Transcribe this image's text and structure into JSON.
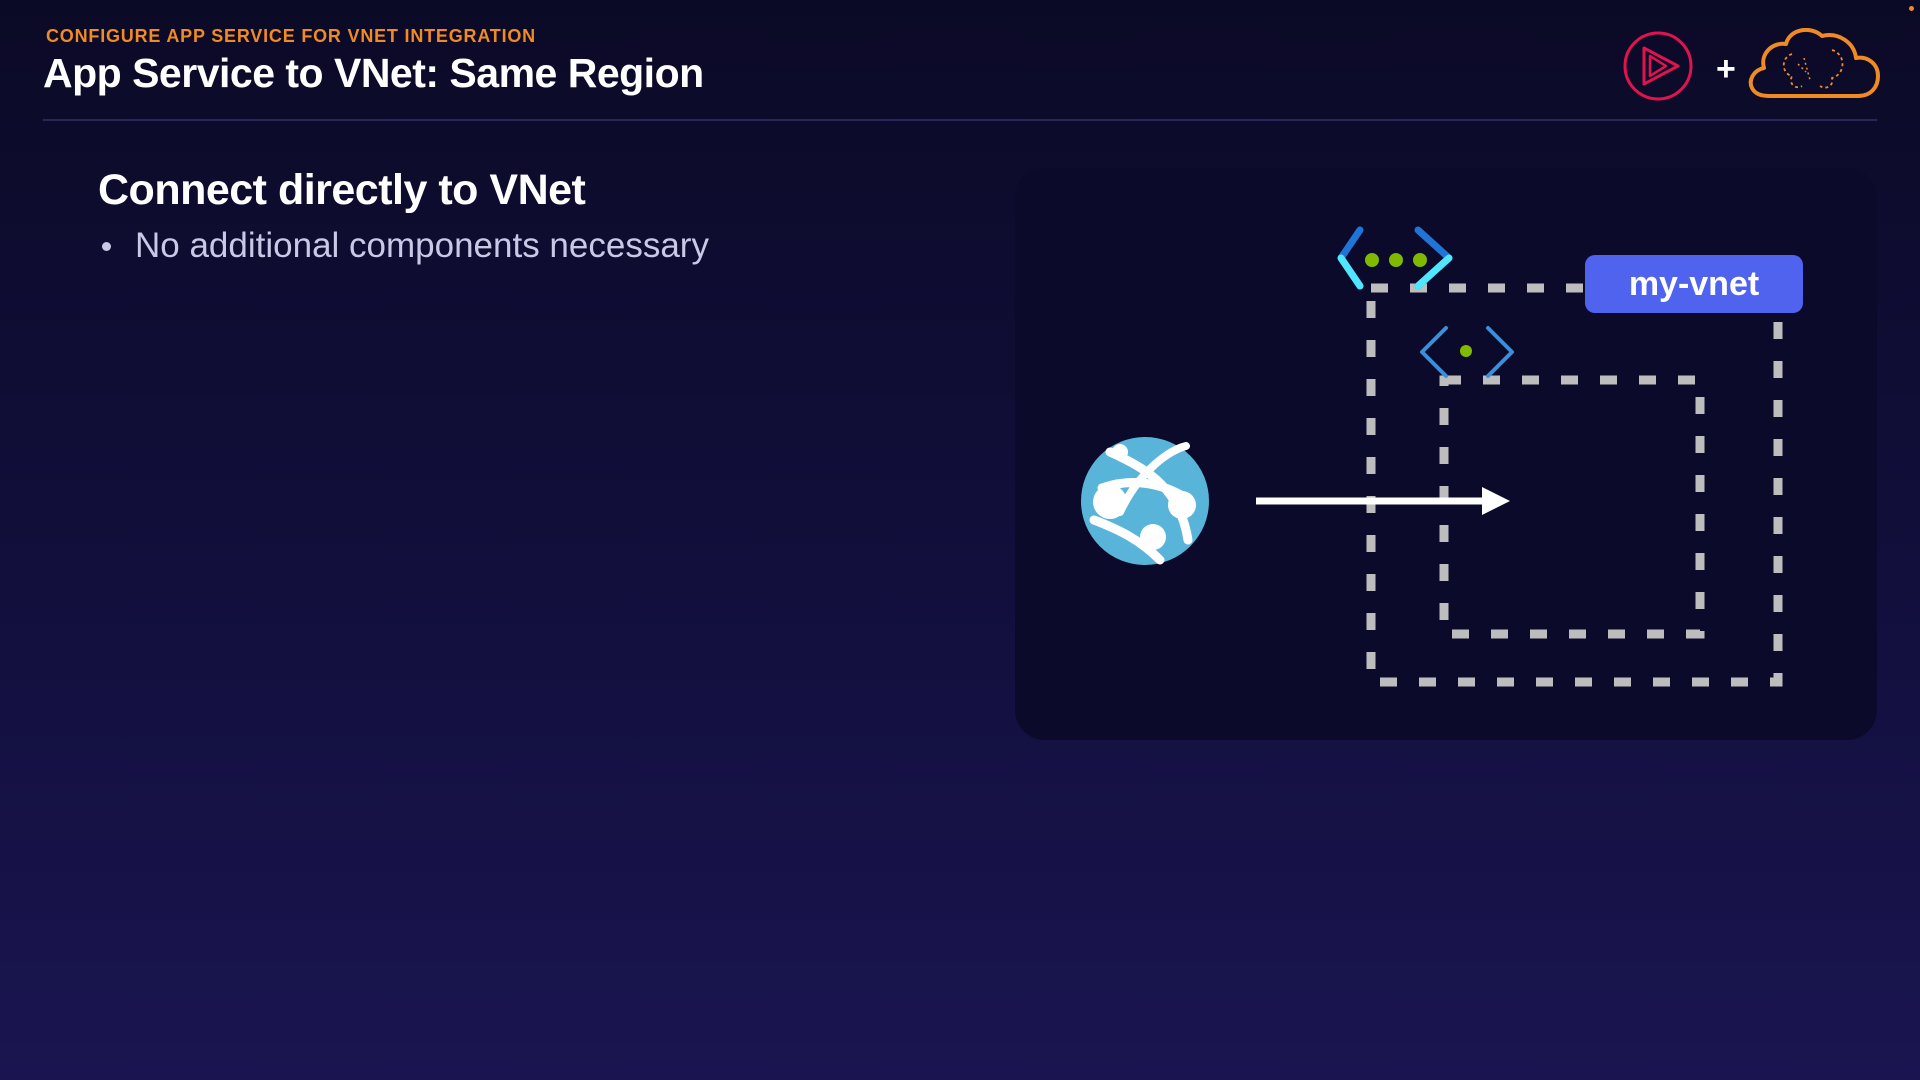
{
  "header": {
    "eyebrow": "CONFIGURE APP SERVICE FOR VNET INTEGRATION",
    "title": "App Service to VNet: Same Region",
    "plus": "+"
  },
  "content": {
    "heading": "Connect directly to VNet",
    "bullets": [
      "No additional components necessary"
    ]
  },
  "diagram": {
    "vnet_label": "my-vnet",
    "icons": {
      "app_service": "app-service-globe-icon",
      "vnet": "vnet-icon",
      "subnet": "subnet-icon",
      "brand_left": "pluralsight-play-icon",
      "brand_right": "cloud-brain-icon"
    }
  },
  "colors": {
    "accent_orange": "#f08a24",
    "label_blue": "#4f63ee",
    "dash_gray": "#bdbdbd",
    "globe_blue": "#59b4d9",
    "pluralsight_red": "#e0134f",
    "vnet_dot_green": "#7fba00"
  }
}
